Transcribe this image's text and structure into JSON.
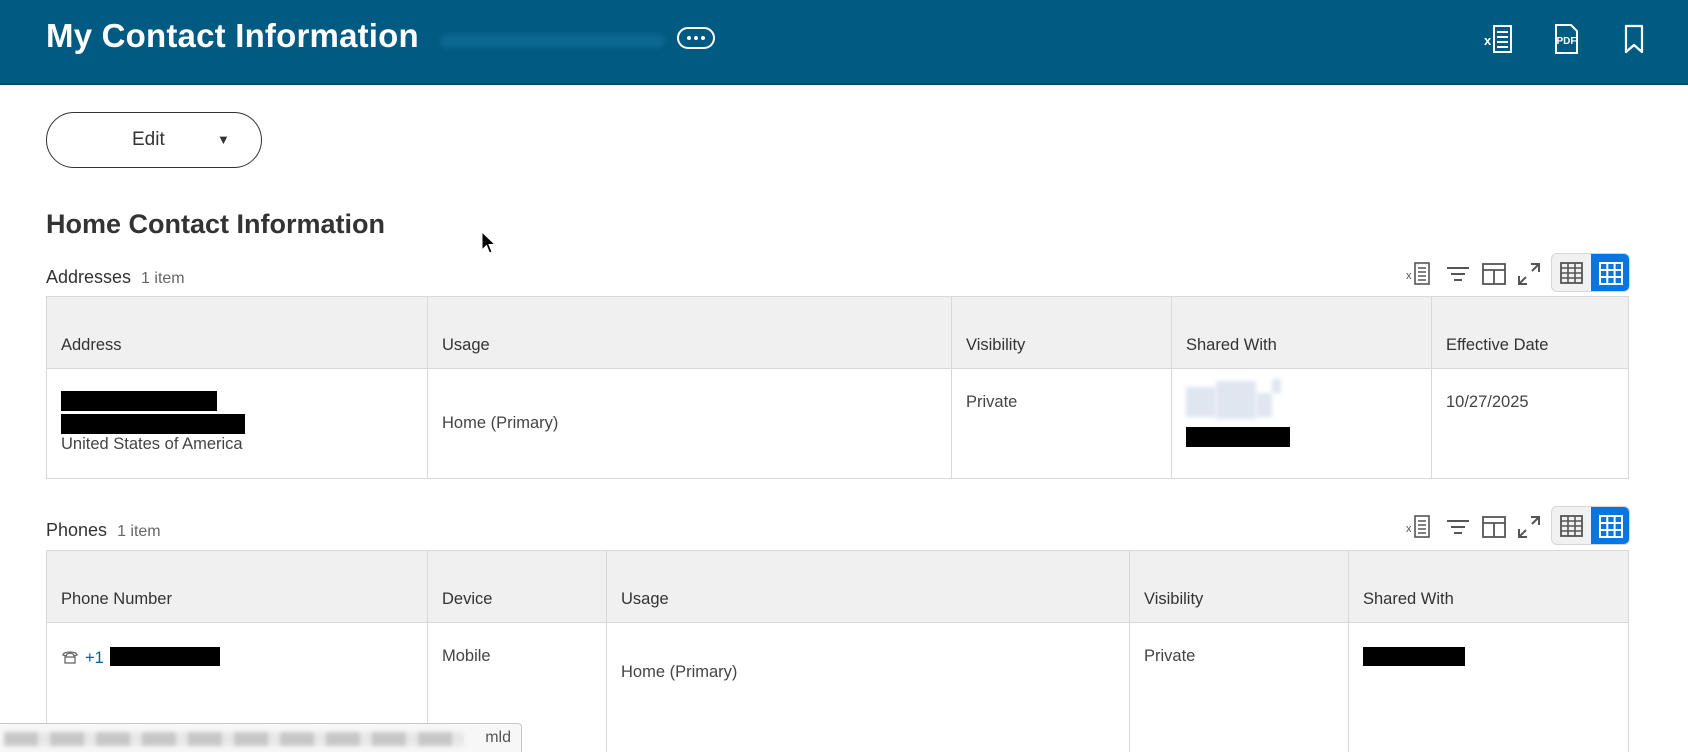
{
  "header": {
    "title": "My Contact Information",
    "more_icon": "ellipsis-icon",
    "actions": [
      {
        "name": "export-excel",
        "icon": "excel-export-icon"
      },
      {
        "name": "export-pdf",
        "icon": "pdf-icon",
        "label": "PDF"
      },
      {
        "name": "bookmark",
        "icon": "bookmark-icon"
      }
    ]
  },
  "edit_button": {
    "label": "Edit",
    "caret": "▼"
  },
  "section": {
    "title": "Home Contact Information"
  },
  "addresses": {
    "title": "Addresses",
    "count": "1 item",
    "columns": [
      "Address",
      "Usage",
      "Visibility",
      "Shared With",
      "Effective Date"
    ],
    "rows": [
      {
        "address_country": "United States of America",
        "usage": "Home (Primary)",
        "visibility": "Private",
        "effective_date": "10/27/2025"
      }
    ]
  },
  "phones": {
    "title": "Phones",
    "count": "1 item",
    "columns": [
      "Phone Number",
      "Device",
      "Usage",
      "Visibility",
      "Shared With"
    ],
    "rows": [
      {
        "phone_prefix": "+1",
        "device": "Mobile",
        "usage": "Home (Primary)",
        "visibility": "Private"
      }
    ]
  },
  "status_bar": {
    "text_tail": "mld"
  },
  "colors": {
    "header_bg": "#005a82",
    "accent": "#0875e1",
    "link": "#0b5cab"
  }
}
